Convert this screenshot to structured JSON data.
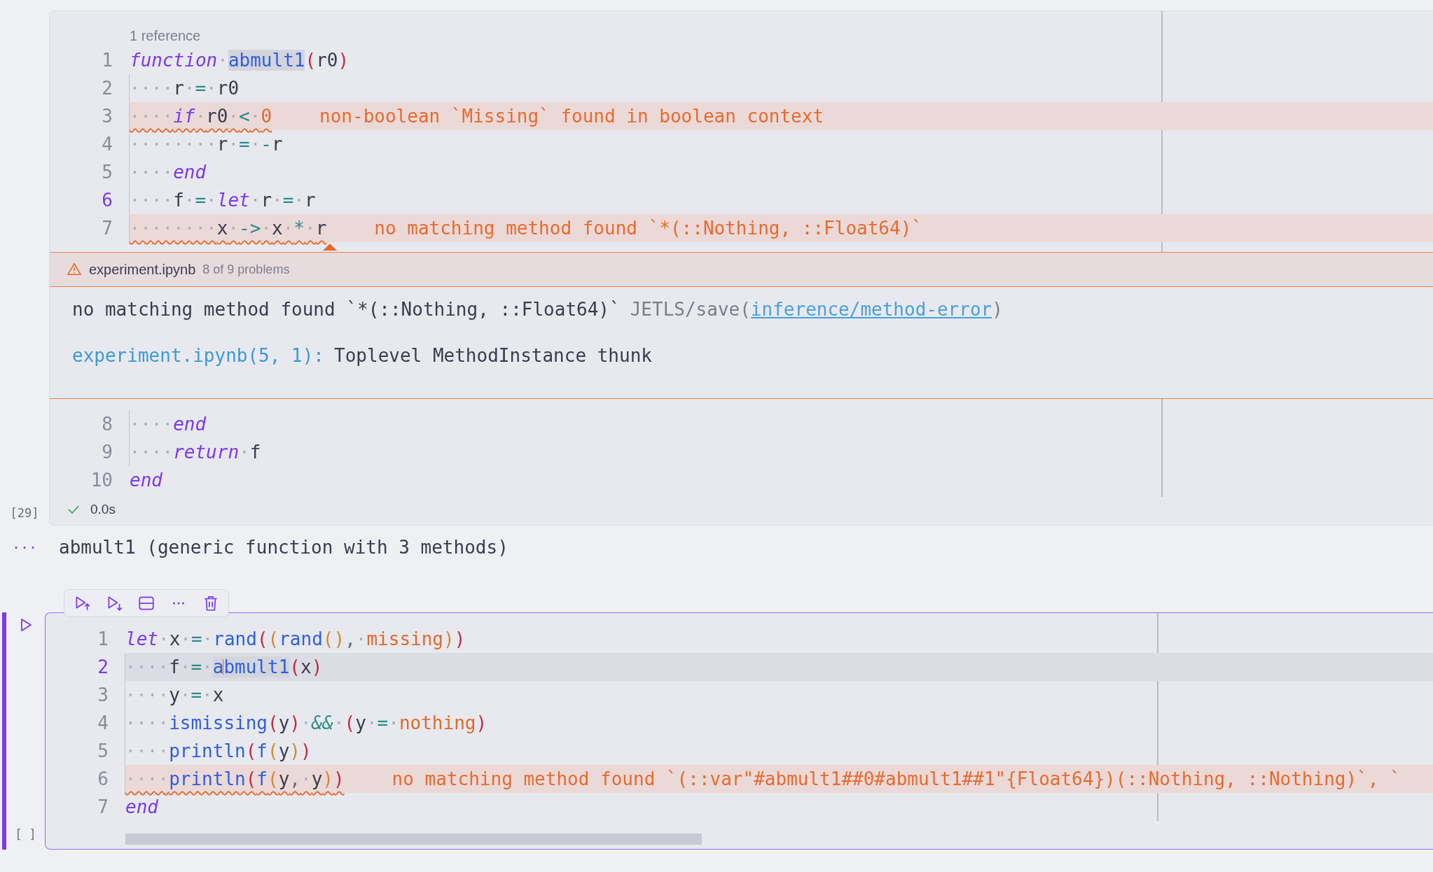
{
  "cells": [
    {
      "focused": false,
      "reference": "1 reference",
      "exec_count": "[29]",
      "status": {
        "ok": true,
        "time": "0.0s"
      },
      "lines": [
        {
          "number": "1",
          "current": false,
          "code": [
            {
              "text": "function",
              "kind": "kw"
            },
            {
              "text": "·",
              "kind": "ws"
            },
            {
              "text": "abmult1",
              "kind": "fn",
              "highlighted": true
            },
            {
              "text": "(",
              "kind": "p1"
            },
            {
              "text": "r0",
              "kind": "id"
            },
            {
              "text": ")",
              "kind": "p1"
            }
          ]
        },
        {
          "number": "2",
          "current": false,
          "code": [
            {
              "text": "····",
              "kind": "ws"
            },
            {
              "text": "r",
              "kind": "id"
            },
            {
              "text": "·",
              "kind": "ws"
            },
            {
              "text": "=",
              "kind": "op"
            },
            {
              "text": "·",
              "kind": "ws"
            },
            {
              "text": "r0",
              "kind": "id"
            }
          ]
        },
        {
          "number": "3",
          "current": false,
          "error": "non-boolean `Missing` found in boolean context",
          "code": [
            {
              "text": "····",
              "kind": "ws"
            },
            {
              "text": "if",
              "kind": "kw"
            },
            {
              "text": "·",
              "kind": "ws"
            },
            {
              "text": "r0",
              "kind": "id"
            },
            {
              "text": "·",
              "kind": "ws"
            },
            {
              "text": "<",
              "kind": "op"
            },
            {
              "text": "·",
              "kind": "ws"
            },
            {
              "text": "0",
              "kind": "lit"
            }
          ]
        },
        {
          "number": "4",
          "current": false,
          "code": [
            {
              "text": "········",
              "kind": "ws"
            },
            {
              "text": "r",
              "kind": "id"
            },
            {
              "text": "·",
              "kind": "ws"
            },
            {
              "text": "=",
              "kind": "op"
            },
            {
              "text": "·",
              "kind": "ws"
            },
            {
              "text": "-",
              "kind": "op"
            },
            {
              "text": "r",
              "kind": "id"
            }
          ]
        },
        {
          "number": "5",
          "current": false,
          "code": [
            {
              "text": "····",
              "kind": "ws"
            },
            {
              "text": "end",
              "kind": "kw"
            }
          ]
        },
        {
          "number": "6",
          "current": true,
          "code": [
            {
              "text": "····",
              "kind": "ws"
            },
            {
              "text": "f",
              "kind": "id"
            },
            {
              "text": "·",
              "kind": "ws"
            },
            {
              "text": "=",
              "kind": "op"
            },
            {
              "text": "·",
              "kind": "ws"
            },
            {
              "text": "let",
              "kind": "kw"
            },
            {
              "text": "·",
              "kind": "ws"
            },
            {
              "text": "r",
              "kind": "id"
            },
            {
              "text": "·",
              "kind": "ws"
            },
            {
              "text": "=",
              "kind": "op"
            },
            {
              "text": "·",
              "kind": "ws"
            },
            {
              "text": "r",
              "kind": "id"
            }
          ]
        },
        {
          "number": "7",
          "current": false,
          "error": "no matching method found `*(::Nothing, ::Float64)`",
          "code": [
            {
              "text": "········",
              "kind": "ws"
            },
            {
              "text": "x",
              "kind": "id"
            },
            {
              "text": "·",
              "kind": "ws"
            },
            {
              "text": "->",
              "kind": "op"
            },
            {
              "text": "·",
              "kind": "ws"
            },
            {
              "text": "x",
              "kind": "id"
            },
            {
              "text": "·",
              "kind": "ws"
            },
            {
              "text": "*",
              "kind": "op"
            },
            {
              "text": "·",
              "kind": "ws"
            },
            {
              "text": "r",
              "kind": "id"
            }
          ],
          "peek": {
            "file": "experiment.ipynb",
            "count": "8 of 9 problems",
            "message": "no matching method found `*(::Nothing, ::Float64)`",
            "source": "JETLS/save(",
            "link": "inference/method-error",
            "source_end": ")",
            "location": "experiment.ipynb(5, 1):",
            "detail": "Toplevel MethodInstance thunk"
          }
        },
        {
          "number": "8",
          "current": false,
          "code": [
            {
              "text": "····",
              "kind": "ws"
            },
            {
              "text": "end",
              "kind": "kw"
            }
          ]
        },
        {
          "number": "9",
          "current": false,
          "code": [
            {
              "text": "····",
              "kind": "ws"
            },
            {
              "text": "return",
              "kind": "kw"
            },
            {
              "text": "·",
              "kind": "ws"
            },
            {
              "text": "f",
              "kind": "id"
            }
          ]
        },
        {
          "number": "10",
          "current": false,
          "code": [
            {
              "text": "end",
              "kind": "kw"
            }
          ]
        }
      ],
      "output": {
        "prompt": "···",
        "text": "abmult1 (generic function with 3 methods)"
      }
    },
    {
      "focused": true,
      "exec_count": "[ ]",
      "lines": [
        {
          "number": "1",
          "current": false,
          "code": [
            {
              "text": "let",
              "kind": "kw"
            },
            {
              "text": "·",
              "kind": "ws"
            },
            {
              "text": "x",
              "kind": "id"
            },
            {
              "text": "·",
              "kind": "ws"
            },
            {
              "text": "=",
              "kind": "op"
            },
            {
              "text": "·",
              "kind": "ws"
            },
            {
              "text": "rand",
              "kind": "fn"
            },
            {
              "text": "(",
              "kind": "p1"
            },
            {
              "text": "(",
              "kind": "p2"
            },
            {
              "text": "rand",
              "kind": "fn"
            },
            {
              "text": "()",
              "kind": "p2"
            },
            {
              "text": ",",
              "kind": "punct"
            },
            {
              "text": "·",
              "kind": "ws"
            },
            {
              "text": "missing",
              "kind": "lit"
            },
            {
              "text": ")",
              "kind": "p2"
            },
            {
              "text": ")",
              "kind": "p1"
            }
          ]
        },
        {
          "number": "2",
          "current": true,
          "code": [
            {
              "text": "····",
              "kind": "ws"
            },
            {
              "text": "f",
              "kind": "id"
            },
            {
              "text": "·",
              "kind": "ws"
            },
            {
              "text": "=",
              "kind": "op"
            },
            {
              "text": "·",
              "kind": "ws"
            },
            {
              "text": "a",
              "kind": "fn",
              "highlighted": true,
              "caret": true
            },
            {
              "text": "bmult1",
              "kind": "fn",
              "highlighted": true
            },
            {
              "text": "(",
              "kind": "p1"
            },
            {
              "text": "x",
              "kind": "id"
            },
            {
              "text": ")",
              "kind": "p1"
            }
          ]
        },
        {
          "number": "3",
          "current": false,
          "code": [
            {
              "text": "····",
              "kind": "ws"
            },
            {
              "text": "y",
              "kind": "id"
            },
            {
              "text": "·",
              "kind": "ws"
            },
            {
              "text": "=",
              "kind": "op"
            },
            {
              "text": "·",
              "kind": "ws"
            },
            {
              "text": "x",
              "kind": "id"
            }
          ]
        },
        {
          "number": "4",
          "current": false,
          "code": [
            {
              "text": "····",
              "kind": "ws"
            },
            {
              "text": "ismissing",
              "kind": "fn"
            },
            {
              "text": "(",
              "kind": "p1"
            },
            {
              "text": "y",
              "kind": "id"
            },
            {
              "text": ")",
              "kind": "p1"
            },
            {
              "text": "·",
              "kind": "ws"
            },
            {
              "text": "&&",
              "kind": "opi"
            },
            {
              "text": "·",
              "kind": "ws"
            },
            {
              "text": "(",
              "kind": "p1"
            },
            {
              "text": "y",
              "kind": "id"
            },
            {
              "text": "·",
              "kind": "ws"
            },
            {
              "text": "=",
              "kind": "op"
            },
            {
              "text": "·",
              "kind": "ws"
            },
            {
              "text": "nothing",
              "kind": "lit"
            },
            {
              "text": ")",
              "kind": "p1"
            }
          ]
        },
        {
          "number": "5",
          "current": false,
          "code": [
            {
              "text": "····",
              "kind": "ws"
            },
            {
              "text": "println",
              "kind": "fn"
            },
            {
              "text": "(",
              "kind": "p1"
            },
            {
              "text": "f",
              "kind": "fn"
            },
            {
              "text": "(",
              "kind": "p2"
            },
            {
              "text": "y",
              "kind": "id"
            },
            {
              "text": ")",
              "kind": "p2"
            },
            {
              "text": ")",
              "kind": "p1"
            }
          ]
        },
        {
          "number": "6",
          "current": false,
          "error": "no matching method found `(::var\"#abmult1##0#abmult1##1\"{Float64})(::Nothing, ::Nothing)`, `",
          "code": [
            {
              "text": "····",
              "kind": "ws"
            },
            {
              "text": "println",
              "kind": "fn"
            },
            {
              "text": "(",
              "kind": "p1"
            },
            {
              "text": "f",
              "kind": "fn"
            },
            {
              "text": "(",
              "kind": "p2"
            },
            {
              "text": "y",
              "kind": "id"
            },
            {
              "text": ",",
              "kind": "punct"
            },
            {
              "text": "·",
              "kind": "ws"
            },
            {
              "text": "y",
              "kind": "id"
            },
            {
              "text": ")",
              "kind": "p2"
            },
            {
              "text": ")",
              "kind": "p1"
            }
          ]
        },
        {
          "number": "7",
          "current": false,
          "code": [
            {
              "text": "end",
              "kind": "kw"
            }
          ]
        }
      ]
    }
  ]
}
